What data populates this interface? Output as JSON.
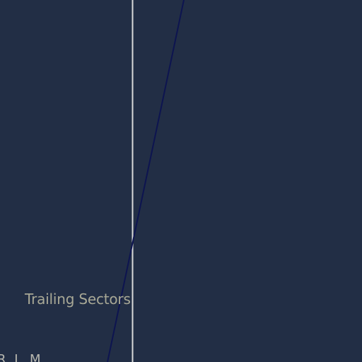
{
  "colors": {
    "background": "#222e45",
    "divider": "#d9d9d9",
    "trend_line": "#0d1450",
    "label_text": "#a8a896"
  },
  "chart_data": {
    "type": "line",
    "title": "",
    "xlabel": "",
    "ylabel": "",
    "quadrant_label": "Trailing Sectors",
    "partial_tick_label": "R  L M",
    "grid": false,
    "series": [
      {
        "values": [
          [
            0.0,
            0.0
          ],
          [
            1.0,
            1.0
          ]
        ]
      }
    ]
  }
}
